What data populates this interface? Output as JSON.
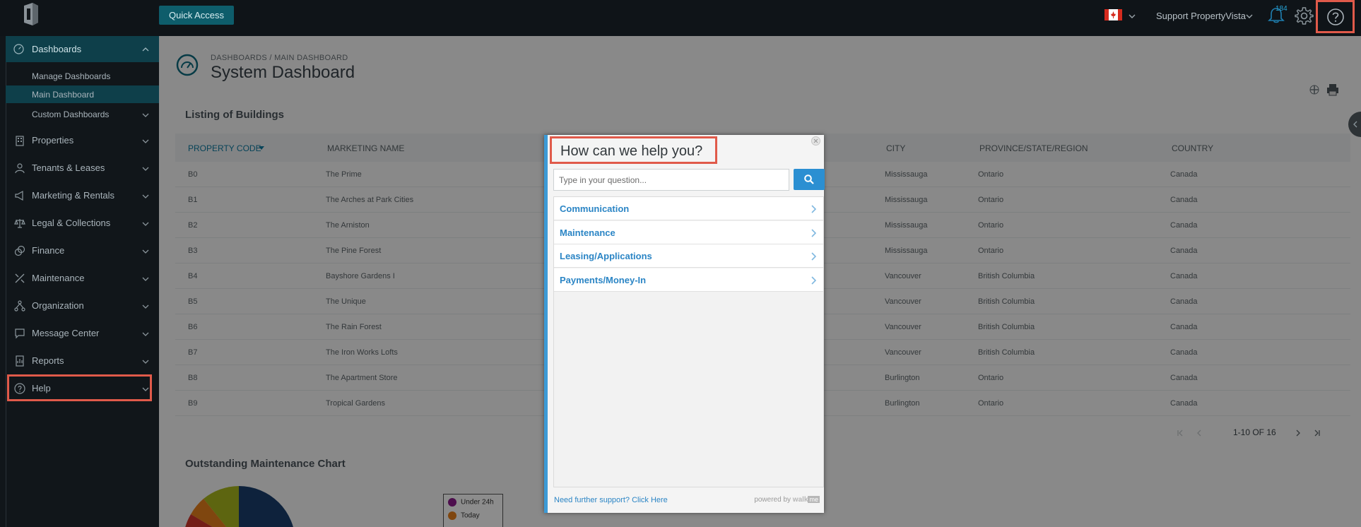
{
  "topbar": {
    "quick_access": "Quick Access",
    "user_name": "Support PropertyVista",
    "notification_count": "184"
  },
  "sidebar": {
    "dashboards": "Dashboards",
    "sub_items": [
      "Manage Dashboards",
      "Main Dashboard",
      "Custom Dashboards"
    ],
    "items": [
      "Properties",
      "Tenants & Leases",
      "Marketing & Rentals",
      "Legal & Collections",
      "Finance",
      "Maintenance",
      "Organization",
      "Message Center",
      "Reports",
      "Help"
    ]
  },
  "page": {
    "breadcrumb": "DASHBOARDS / MAIN DASHBOARD",
    "title": "System Dashboard",
    "listing_title": "Listing of Buildings",
    "chart_title": "Outstanding Maintenance Chart"
  },
  "table": {
    "headers": [
      "PROPERTY CODE",
      "MARKETING NAME",
      "CITY",
      "PROVINCE/STATE/REGION",
      "COUNTRY"
    ],
    "rows": [
      [
        "B0",
        "The Prime",
        "Mississauga",
        "Ontario",
        "Canada"
      ],
      [
        "B1",
        "The Arches at Park Cities",
        "Mississauga",
        "Ontario",
        "Canada"
      ],
      [
        "B2",
        "The Arniston",
        "Mississauga",
        "Ontario",
        "Canada"
      ],
      [
        "B3",
        "The Pine Forest",
        "Mississauga",
        "Ontario",
        "Canada"
      ],
      [
        "B4",
        "Bayshore Gardens I",
        "Vancouver",
        "British Columbia",
        "Canada"
      ],
      [
        "B5",
        "The Unique",
        "Vancouver",
        "British Columbia",
        "Canada"
      ],
      [
        "B6",
        "The Rain Forest",
        "Vancouver",
        "British Columbia",
        "Canada"
      ],
      [
        "B7",
        "The Iron Works Lofts",
        "Vancouver",
        "British Columbia",
        "Canada"
      ],
      [
        "B8",
        "The Apartment Store",
        "Burlington",
        "Ontario",
        "Canada"
      ],
      [
        "B9",
        "Tropical Gardens",
        "Burlington",
        "Ontario",
        "Canada"
      ]
    ],
    "pagination": "1-10 OF 16"
  },
  "legend": [
    "Under 24h",
    "Today"
  ],
  "modal": {
    "title": "How can we help you?",
    "search_placeholder": "Type in your question...",
    "categories": [
      "Communication",
      "Maintenance",
      "Leasing/Applications",
      "Payments/Money-In"
    ],
    "footer_link": "Need further support? Click Here",
    "powered_by": "powered by",
    "brand": "walk",
    "brand_box": "me"
  },
  "colors": {
    "accent": "#0e3f4a",
    "link": "#2b85c5",
    "highlight": "#e05a4a"
  }
}
